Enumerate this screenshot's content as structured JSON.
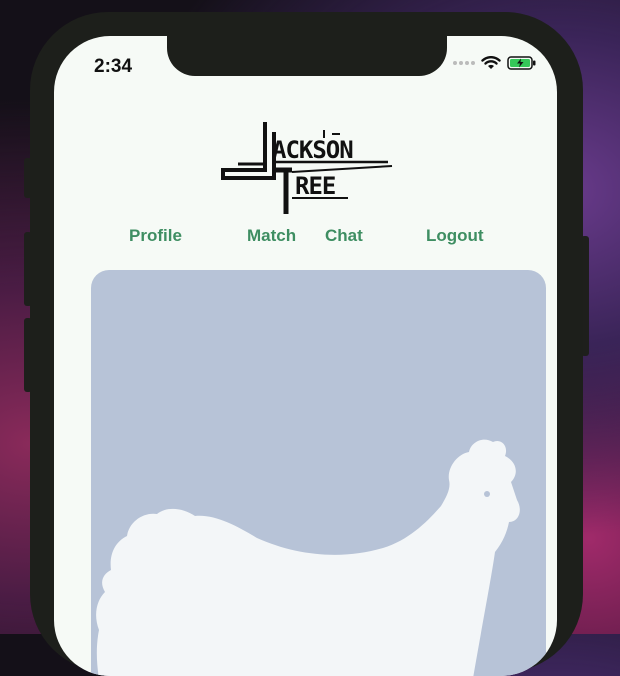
{
  "status_bar": {
    "time": "2:34",
    "icons": [
      "signal-dots-icon",
      "wifi-icon",
      "battery-charging-icon"
    ]
  },
  "app": {
    "logo_text_line1": "JACKSON",
    "logo_text_line2": "TREE"
  },
  "nav": {
    "profile": "Profile",
    "match": "Match",
    "chat": "Chat",
    "logout": "Logout"
  },
  "card": {
    "image": "chicken-silhouette-placeholder"
  },
  "colors": {
    "screen_bg": "#f6faf6",
    "nav_link": "#3e8e62",
    "card_bg": "#b7c3d7",
    "phone_frame": "#1d1f1b"
  }
}
